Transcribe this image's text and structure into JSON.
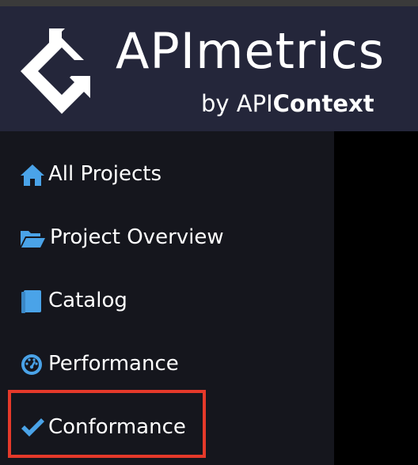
{
  "header": {
    "brand_title": "APImetrics",
    "brand_by": "by API",
    "brand_context": "Context"
  },
  "sidebar": {
    "items": [
      {
        "label": "All Projects",
        "icon": "home-icon"
      },
      {
        "label": "Project Overview",
        "icon": "folder-open-icon"
      },
      {
        "label": "Catalog",
        "icon": "book-icon"
      },
      {
        "label": "Performance",
        "icon": "dashboard-gauge-icon"
      },
      {
        "label": "Conformance",
        "icon": "checkmark-icon",
        "highlighted": true
      }
    ]
  },
  "colors": {
    "header_bg": "#24263a",
    "sidebar_bg": "#15161d",
    "icon_accent": "#4aa3e8",
    "highlight": "#e5392a"
  }
}
